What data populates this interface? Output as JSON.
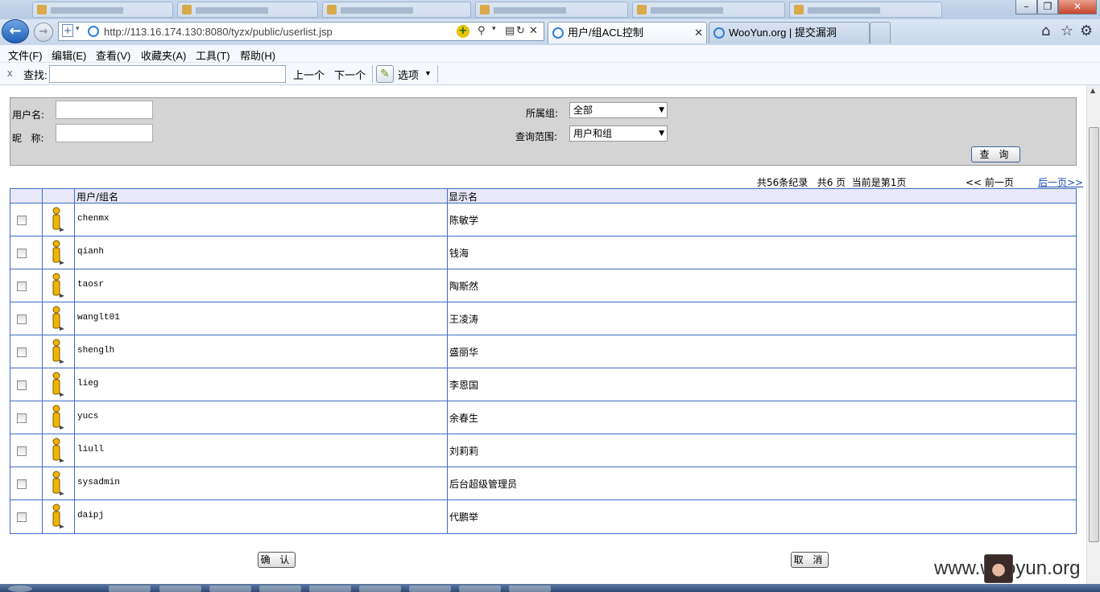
{
  "browser": {
    "url": "http://113.16.174.130:8080/tyzx/public/userlist.jsp",
    "tabs": [
      {
        "label": "用户/组ACL控制",
        "active": true
      },
      {
        "label": "WooYun.org | 提交漏洞",
        "active": false
      }
    ],
    "tab_close": "✕",
    "window_controls": {
      "minimize": "–",
      "maximize": "❐",
      "close": "✕"
    }
  },
  "menu": [
    "文件(F)",
    "编辑(E)",
    "查看(V)",
    "收藏夹(A)",
    "工具(T)",
    "帮助(H)"
  ],
  "findbar": {
    "close": "x",
    "label": "查找:",
    "prev": "上一个",
    "next": "下一个",
    "options": "选项"
  },
  "search": {
    "username_label": "用户名:",
    "nickname_label": "昵   称:",
    "group_label": "所属组:",
    "group_value": "全部",
    "scope_label": "查询范围:",
    "scope_value": "用户和组",
    "query_button": "查 询"
  },
  "pager": {
    "summary": "共56条纪录   共6 页  当前是第1页",
    "prev": "<< 前一页",
    "next": "后一页>>"
  },
  "table": {
    "headers": {
      "name": "用户/组名",
      "display": "显示名"
    },
    "rows": [
      {
        "name": "chenmx",
        "display": "陈敏学"
      },
      {
        "name": "qianh",
        "display": "钱海"
      },
      {
        "name": "taosr",
        "display": "陶斯然"
      },
      {
        "name": "wanglt01",
        "display": "王凌涛"
      },
      {
        "name": "shenglh",
        "display": "盛丽华"
      },
      {
        "name": "lieg",
        "display": "李恩国"
      },
      {
        "name": "yucs",
        "display": "余春生"
      },
      {
        "name": "liull",
        "display": "刘莉莉"
      },
      {
        "name": "sysadmin",
        "display": "后台超级管理员"
      },
      {
        "name": "daipj",
        "display": "代鹏举"
      }
    ]
  },
  "actions": {
    "confirm": "确 认",
    "cancel": "取 消"
  },
  "watermark": "www.wooyun.org",
  "colors": {
    "grid_border": "#3c6fc4",
    "header_bg": "#e8e8f8",
    "link": "#1f4fb0",
    "user_icon": "#f0b400"
  }
}
